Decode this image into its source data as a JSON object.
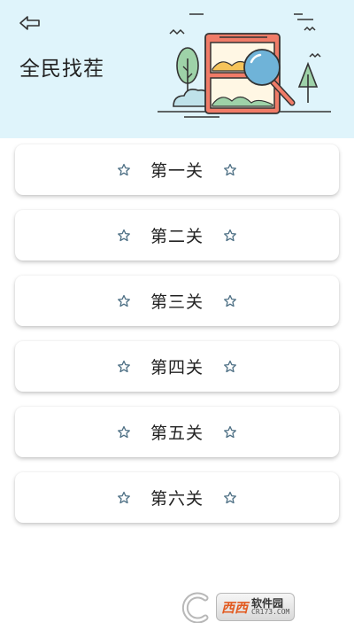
{
  "header": {
    "title": "全民找茬",
    "back_icon": "back-arrow-icon",
    "background_color": "#dff4fb"
  },
  "levels": [
    {
      "label": "第一关",
      "icon": "star-outline-icon"
    },
    {
      "label": "第二关",
      "icon": "star-outline-icon"
    },
    {
      "label": "第三关",
      "icon": "star-outline-icon"
    },
    {
      "label": "第四关",
      "icon": "star-outline-icon"
    },
    {
      "label": "第五关",
      "icon": "star-outline-icon"
    },
    {
      "label": "第六关",
      "icon": "star-outline-icon"
    }
  ],
  "watermark": {
    "brand": "西西",
    "name": "软件园",
    "url": "CR173.COM"
  },
  "colors": {
    "star": "#4d6f84",
    "illustration_frame": "#f07c68",
    "illustration_magnifier": "#6fb3d8",
    "illustration_tree": "#9ed2a8"
  }
}
